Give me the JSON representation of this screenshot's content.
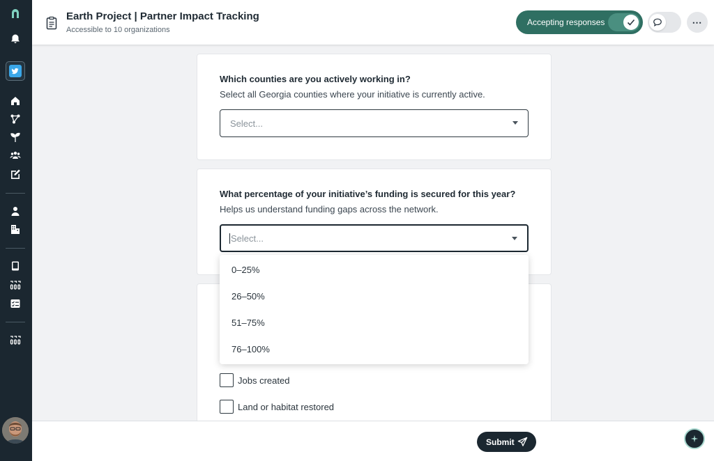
{
  "header": {
    "title": "Earth Project | Partner Impact Tracking",
    "subtitle": "Accessible to 10 organizations",
    "accepting_label": "Accepting responses",
    "more_label": "⋯"
  },
  "questions": [
    {
      "title": "Which counties are you actively working in?",
      "help": "Select all Georgia counties where your initiative is currently active.",
      "placeholder": "Select..."
    },
    {
      "title": "What percentage of your initiative’s funding is secured for this year?",
      "help": "Helps us understand funding gaps across the network.",
      "placeholder": "Select..."
    }
  ],
  "dropdown_options": [
    "0–25%",
    "26–50%",
    "51–75%",
    "76–100%"
  ],
  "checkboxes": [
    {
      "label": "Jobs created",
      "checked": false
    },
    {
      "label": "Land or habitat restored",
      "checked": false
    }
  ],
  "footer": {
    "submit_label": "Submit"
  },
  "colors": {
    "sidebar": "#1b2730",
    "accent_green": "#2f6f62",
    "active_icon": "#3aa7e8"
  }
}
